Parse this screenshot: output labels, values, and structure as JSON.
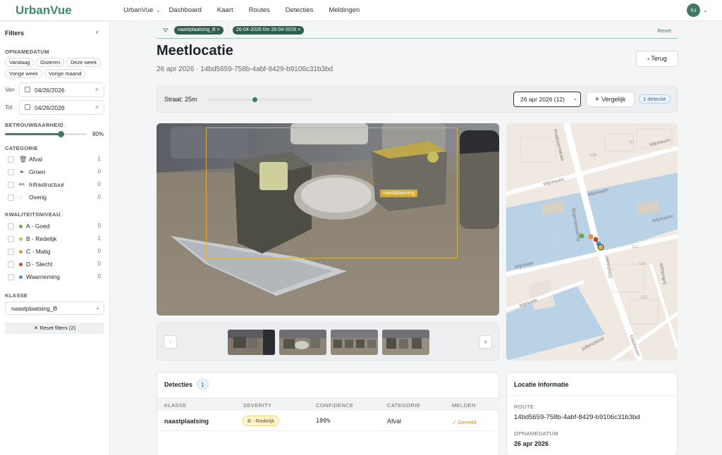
{
  "app": {
    "brand": "UrbanVue",
    "nav": [
      "UrbanVue",
      "Dashboard",
      "Kaart",
      "Routes",
      "Detecties",
      "Meldingen"
    ],
    "user_initials": "IU"
  },
  "sidebar": {
    "title": "Filters",
    "opnamedatum_label": "OPNAMEDATUM",
    "quick": [
      "Vandaag",
      "Gisteren",
      "Deze week",
      "Vorige week",
      "Vorige maand"
    ],
    "van_label": "Van",
    "van_value": "04/26/2026",
    "tot_label": "Tot",
    "tot_value": "04/26/2026",
    "betrouwbaarheid_label": "BETROUWBAARHEID",
    "betrouwbaarheid_value": "80%",
    "betrouwbaarheid_level": 0.8,
    "categorie_label": "CATEGORIE",
    "categories": [
      {
        "label": "Afval",
        "count": "1",
        "icon": "trash-icon"
      },
      {
        "label": "Groen",
        "count": "0",
        "icon": "leaf-icon"
      },
      {
        "label": "Infrastructuur",
        "count": "0",
        "icon": "bridge-icon"
      },
      {
        "label": "Overig",
        "count": "0",
        "icon": "circle-dots-icon"
      }
    ],
    "kwaliteit_label": "KWALITEITSNIVEAU",
    "kwaliteit": [
      {
        "label": "A - Goed",
        "count": "0",
        "color": "#6aa84f"
      },
      {
        "label": "B - Redelijk",
        "count": "1",
        "color": "#e0b93a"
      },
      {
        "label": "C - Matig",
        "count": "0",
        "color": "#e69138"
      },
      {
        "label": "D - Slecht",
        "count": "0",
        "color": "#cc4125"
      },
      {
        "label": "Waarneming",
        "count": "0",
        "color": "#4a90d9"
      }
    ],
    "klasse_label": "KLASSE",
    "klasse_value": "naastplaatsing_B",
    "reset_label": "Reset filters (2)"
  },
  "filterbar": {
    "tags": [
      "naastplaatsing_B",
      "26-04-2026 t/m 26-04-2026"
    ],
    "reset": "Reset"
  },
  "header": {
    "title": "Meetlocatie",
    "subtitle": "26 apr 2026 · 14bd5659-758b-4abf-8429-b9106c31b3bd",
    "back": "Terug"
  },
  "controls": {
    "straat": "Straat: 25m",
    "straat_level": 0.45,
    "date_select": "26 apr 2026 (12)",
    "vergelijk": "Vergelijk",
    "badge": "1 detectie"
  },
  "photo": {
    "bbox_label": "naastplaatsing"
  },
  "map": {
    "streets": [
      "Wijnhaven",
      "Posthoornstraat",
      "Wijnhaven",
      "Wijnhaven",
      "Regentessebrug",
      "Wijnkade",
      "Glashaven",
      "Wijnkade",
      "Juffersstraat",
      "Juffersstraat",
      "Juffertkade",
      "Glashaven"
    ],
    "numbers": [
      "106",
      "97",
      "95",
      "108",
      "100",
      "112",
      "118",
      "125",
      "97"
    ]
  },
  "detecties": {
    "title": "Detecties",
    "count": "1",
    "columns": [
      "KLASSE",
      "SEVERITY",
      "CONFIDENCE",
      "CATEGORIE",
      "MELDEN"
    ],
    "row": {
      "klasse": "naastplaatsing",
      "severity": "B - Redelijk",
      "confidence": "100%",
      "categorie": "Afval",
      "melden": "✓ Gemeld"
    }
  },
  "locatie": {
    "title": "Locatie Informatie",
    "route_label": "ROUTE",
    "route_value": "14bd5659-758b-4abf-8429-b9106c31b3bd",
    "opname_label": "OPNAMEDATUM",
    "opname_value": "26 apr 2026"
  }
}
